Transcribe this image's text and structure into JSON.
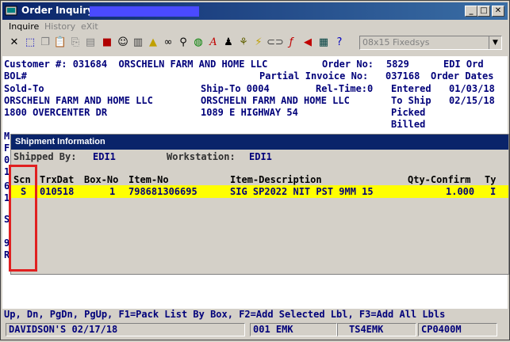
{
  "window": {
    "title": "Order Inquiry - ",
    "title_color": "#0a246a"
  },
  "menu": {
    "inquire": "Inquire",
    "history": "History",
    "exit": "eXit"
  },
  "toolbar": {
    "font_select": "08x15 Fixedsys"
  },
  "header": {
    "line1_left": "Customer #: 031684  ORSCHELN FARM AND HOME LLC",
    "line1_order_label": "Order No:",
    "line1_order_value": "5829",
    "line1_edi": "EDI Ord",
    "line2_left": "BOL#",
    "line2_partial": "Partial Invoice No:",
    "line2_invoice": "037168",
    "line2_dates": "Order Dates",
    "soldto_label": "Sold-To",
    "shipto_label": "Ship-To 0004",
    "reltime_label": "Rel-Time:0",
    "entered_label": "Entered",
    "entered_value": "01/03/18",
    "sold_name": "ORSCHELN FARM AND HOME LLC",
    "ship_name": "ORSCHELN FARM AND HOME LLC",
    "toship_label": "To Ship",
    "toship_value": "02/15/18",
    "sold_addr": "1800 OVERCENTER DR",
    "ship_addr": "1089 E HIGHWAY 54",
    "picked_label": "Picked",
    "billed_label": "Billed"
  },
  "left_glimpse": [
    "M",
    "F",
    "0",
    "1",
    "6",
    "1",
    "S",
    "9",
    "R"
  ],
  "dialog": {
    "title": "Shipment Information",
    "shipped_by_label": "Shipped By:",
    "shipped_by_value": "EDI1",
    "workstation_label": "Workstation:",
    "workstation_value": "EDI1",
    "columns": [
      "Scn",
      "TrxDat",
      "Box-No",
      "Item-No",
      "Item-Description",
      "Qty-Confirm",
      "Ty"
    ],
    "rows": [
      {
        "scn": "S",
        "trxdat": "010518",
        "box_no": "1",
        "item_no": "798681306695",
        "description": "SIG SP2022 NIT PST 9MM 15",
        "qty_confirm": "1.000",
        "ty": "I"
      }
    ],
    "highlight_color": "#ffff00"
  },
  "status_line": "Up, Dn, PgDn, PgUp, F1=Pack List By Box, F2=Add Selected Lbl, F3=Add All Lbls",
  "statusbar": {
    "user": "DAVIDSON'S 02/17/18",
    "emp": "001 EMK",
    "station": "TS4EMK",
    "program": "CP0400M"
  },
  "annotation_color": "#e02020"
}
